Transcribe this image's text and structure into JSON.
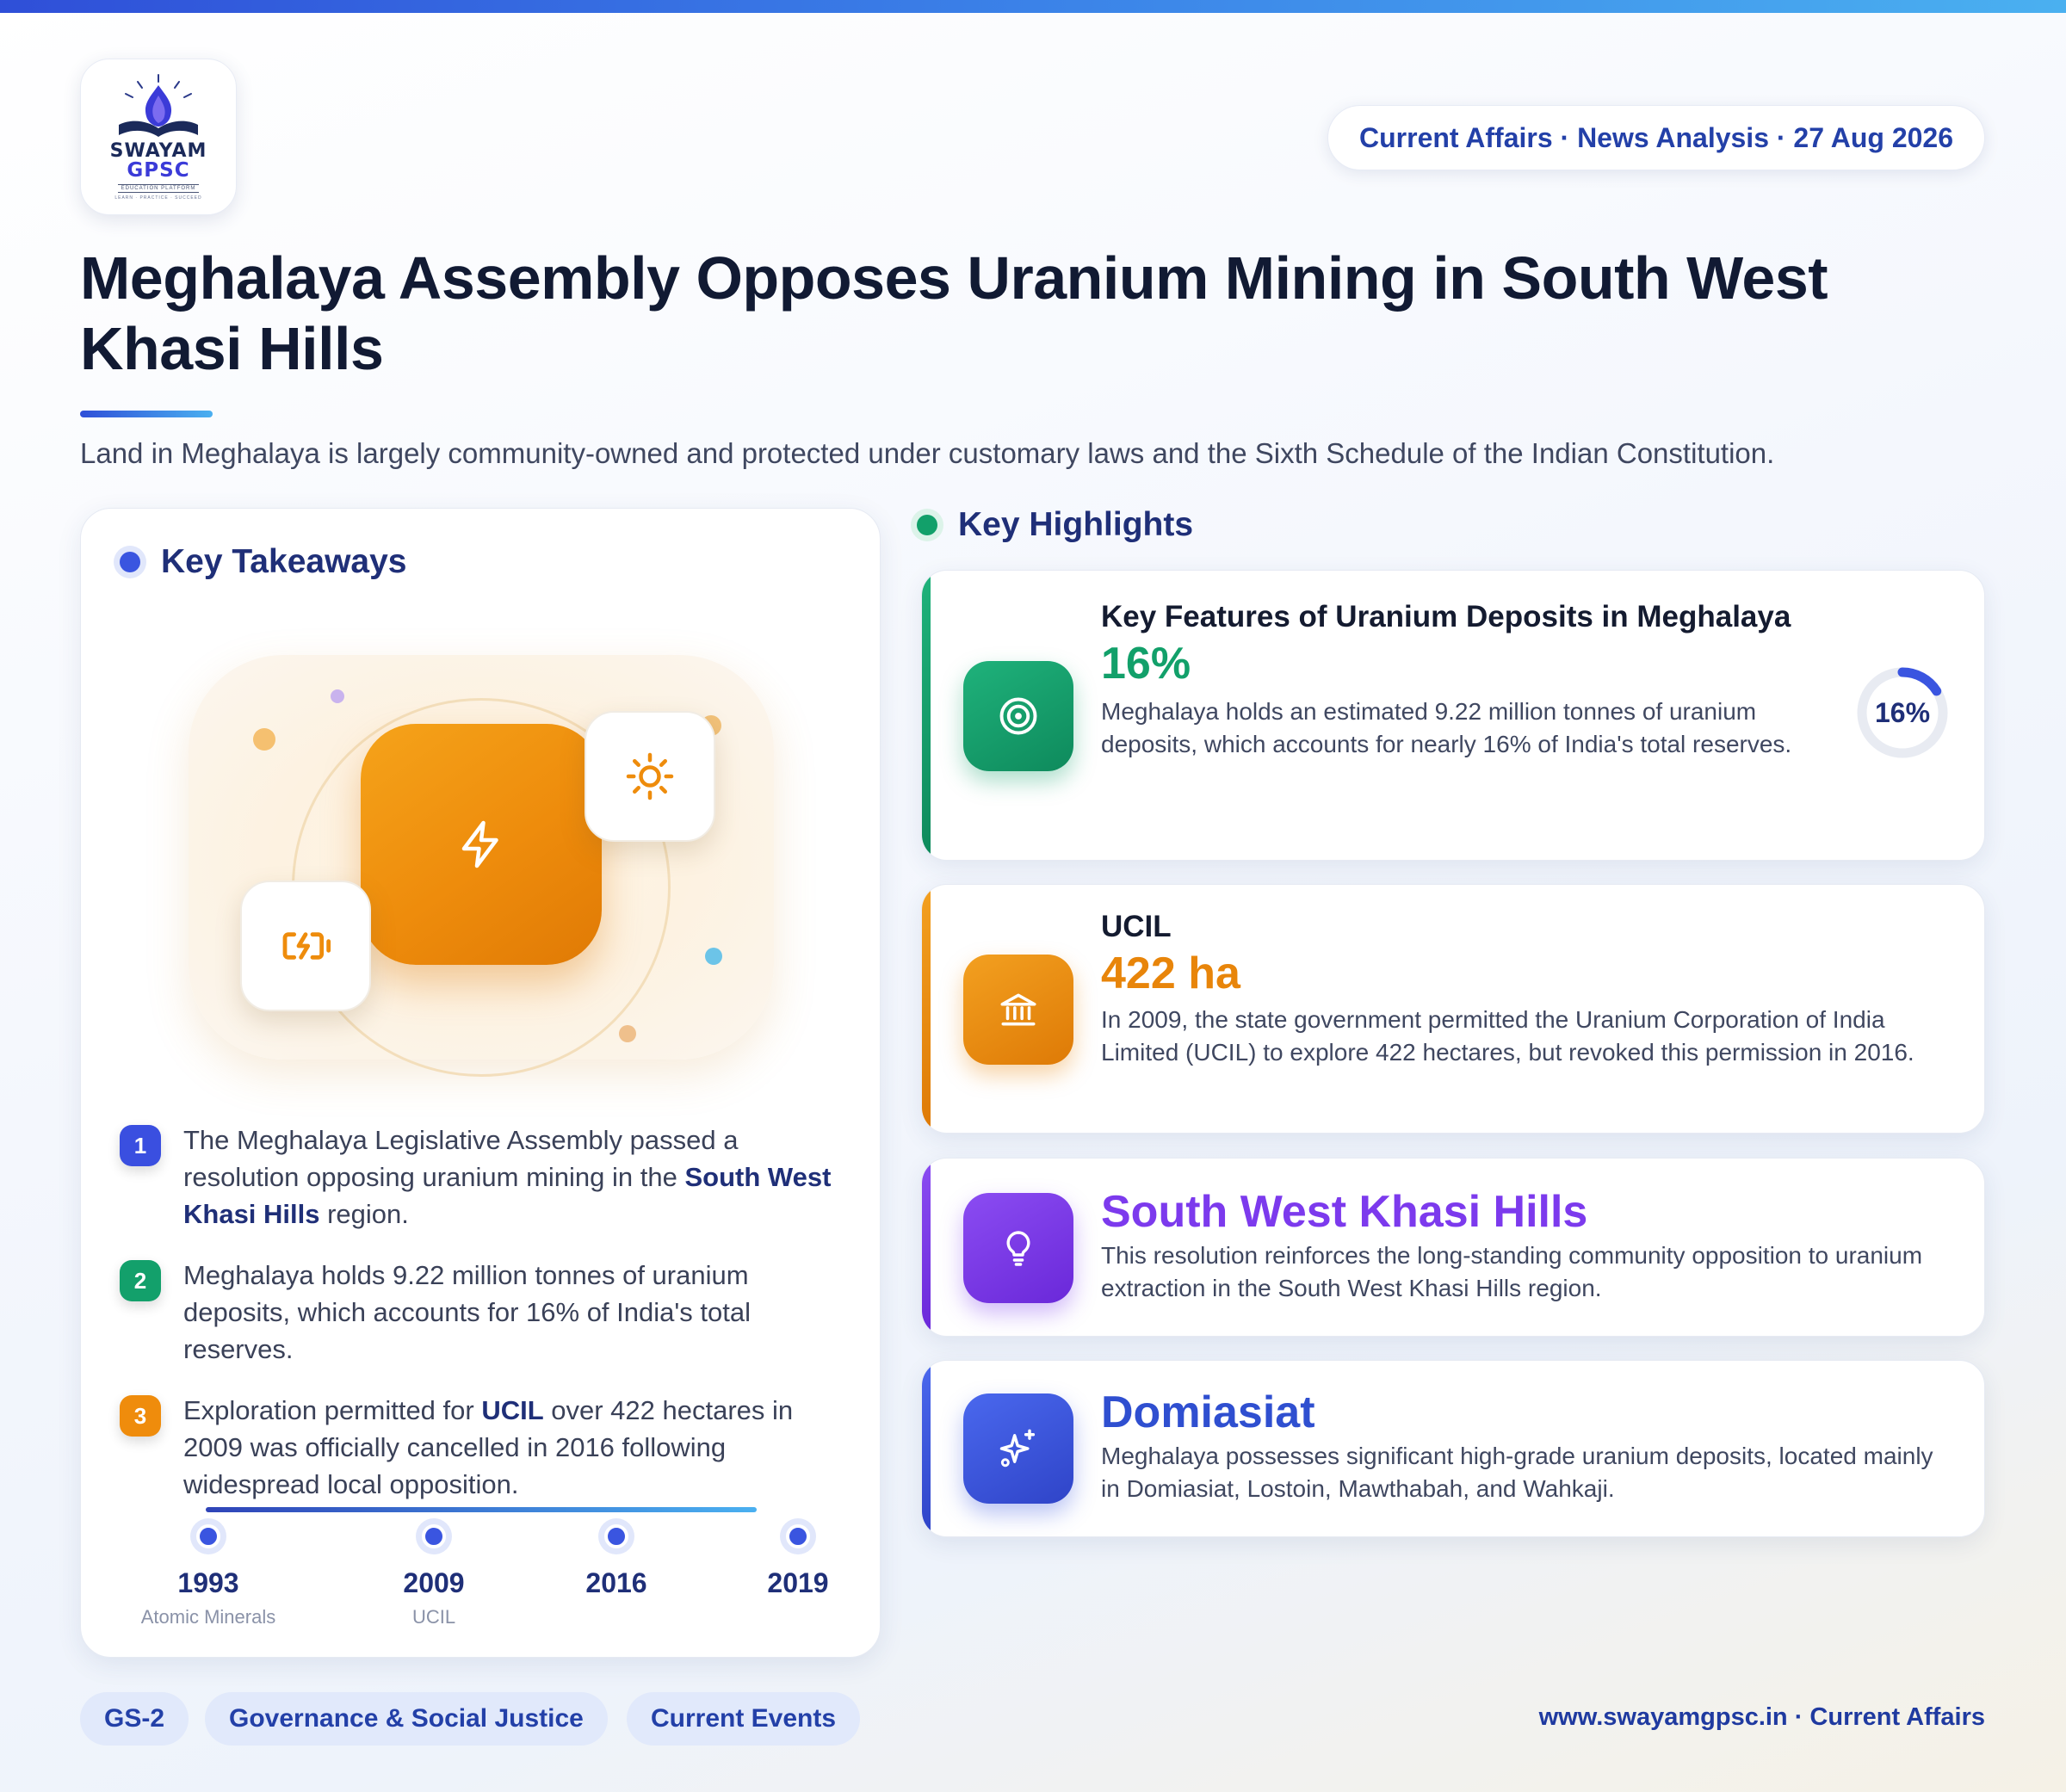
{
  "header": {
    "logo": {
      "line1": "SWAYAM",
      "line2": "GPSC",
      "line3": "EDUCATION PLATFORM",
      "line4": "LEARN · PRACTICE · SUCCEED"
    },
    "meta": "Current Affairs · News Analysis · 27 Aug 2026",
    "title": "Meghalaya Assembly Opposes Uranium Mining in South West Khasi Hills",
    "subtitle": "Land in Meghalaya is largely community-owned and protected under customary laws and the Sixth Schedule of the Indian Constitution."
  },
  "takeaways": {
    "heading": "Key Takeaways",
    "items": [
      {
        "num": "1",
        "pre": "The Meghalaya Legislative Assembly passed a resolution opposing uranium mining in the ",
        "bold": "South West Khasi Hills",
        "post": " region.",
        "color": "#3a4fe0"
      },
      {
        "num": "2",
        "pre": "Meghalaya holds 9.22 million tonnes of uranium deposits, which accounts for 16% of India's total reserves.",
        "bold": "",
        "post": "",
        "color": "#13a06b"
      },
      {
        "num": "3",
        "pre": "Exploration permitted for ",
        "bold": "UCIL",
        "post": " over 422 hectares in 2009 was officially cancelled in 2016 following widespread local opposition.",
        "color": "#ef8c0c"
      }
    ],
    "timeline": [
      {
        "year": "1993",
        "label": "Atomic Minerals"
      },
      {
        "year": "2009",
        "label": "UCIL"
      },
      {
        "year": "2016",
        "label": ""
      },
      {
        "year": "2019",
        "label": ""
      }
    ]
  },
  "highlights": {
    "heading": "Key Highlights",
    "cards": [
      {
        "title": "Key Features of Uranium Deposits in Meghalaya",
        "stat": "16%",
        "desc": "Meghalaya holds an estimated 9.22 million tonnes of uranium deposits, which accounts for nearly 16% of India's total reserves.",
        "donut_label": "16%",
        "donut_value": 0.16,
        "icon": "target-icon",
        "color": "#12a06a"
      },
      {
        "title": "UCIL",
        "stat": "422 ha",
        "desc": "In 2009, the state government permitted the Uranium Corporation of India Limited (UCIL) to explore 422 hectares, but revoked this permission in 2016.",
        "icon": "bank-icon",
        "color": "#e8850a"
      },
      {
        "title": "South West Khasi Hills",
        "desc": "This resolution reinforces the long-standing community opposition to uranium extraction in the South West Khasi Hills region.",
        "icon": "lightbulb-icon",
        "color": "#7c3aed"
      },
      {
        "title": "Domiasiat",
        "desc": "Meghalaya possesses significant high-grade uranium deposits, located mainly in Domiasiat, Lostoin, Mawthabah, and Wahkaji.",
        "icon": "sparkle-icon",
        "color": "#3a55e0"
      }
    ]
  },
  "footer": {
    "tags": [
      "GS-2",
      "Governance & Social Justice",
      "Current Events"
    ],
    "site": "www.swayamgpsc.in · Current Affairs"
  }
}
